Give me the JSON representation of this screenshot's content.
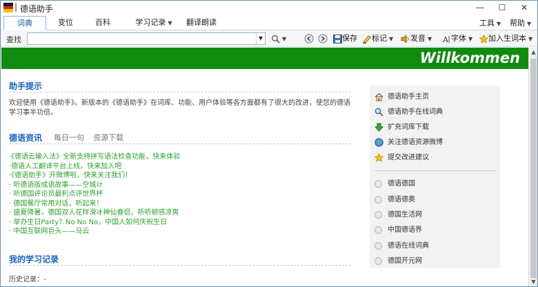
{
  "window": {
    "title": "德语助手",
    "title_sep": "|"
  },
  "window_controls": {
    "minimize": "—",
    "maximize": "☐",
    "close": "✕"
  },
  "tabs": [
    {
      "label": "词典",
      "active": true
    },
    {
      "label": "变位",
      "active": false
    },
    {
      "label": "百科",
      "active": false
    },
    {
      "label": "学习记录",
      "active": false,
      "has_dropdown": true
    },
    {
      "label": "翻译朗读",
      "active": false
    }
  ],
  "menu": {
    "tools": "工具",
    "help": "帮助"
  },
  "toolbar": {
    "find_label": "查找",
    "search_value": "",
    "save": "保存",
    "mark": "标记",
    "pronounce": "发音",
    "font": "字体",
    "add_vocab": "加入生词本"
  },
  "banner": {
    "text": "Willkommen",
    "color": "#118b0f"
  },
  "assistant_tips": {
    "title": "助手提示",
    "text": "欢迎使用《德语助手》。新版本的《德语助手》在词库、功能、用户体验等各方面都有了很大的改进，使您的德语学习事半功倍。"
  },
  "news": {
    "tabs": [
      "德语资讯",
      "每日一句",
      "资源下载"
    ],
    "items": [
      "·《德语云输入法》全新支持拼写语法检查功能，快来体验",
      "·德语人工翻译平台上线，快来加入吧",
      "·《德语助手》开微博啦，快来关注我们！",
      "· 听德语版成语故事——空城计",
      "· 听德国评论员最利点评世界杯",
      "· 德国餐厅常用对话，听起来！",
      "· 盛夏降暑，德国双人花样滑冰神仙眷侣，听听顿感凉爽",
      "· 举办生日Party？No No No，中国人如何庆祝生日",
      "· 中国互联网巨头——马云"
    ]
  },
  "study": {
    "title": "我的学习记录",
    "history": "历史记录：-"
  },
  "right_panel": {
    "links": [
      {
        "label": "德语助手主页",
        "icon": "home-icon"
      },
      {
        "label": "德语助手在线词典",
        "icon": "magnifier-icon"
      },
      {
        "label": "扩充词库下载",
        "icon": "download-arrow-icon"
      },
      {
        "label": "关注德语资源微博",
        "icon": "globe-icon"
      },
      {
        "label": "提交改进建议",
        "icon": "star-icon"
      }
    ],
    "sites": [
      "德语德国",
      "德语德奥",
      "德国生活网",
      "中国德语界",
      "德语在线词典",
      "德国开元网"
    ]
  },
  "colors": {
    "link_blue": "#1a63c0",
    "news_green": "#2e9f2e",
    "panel_bg": "#f2f2f2"
  }
}
